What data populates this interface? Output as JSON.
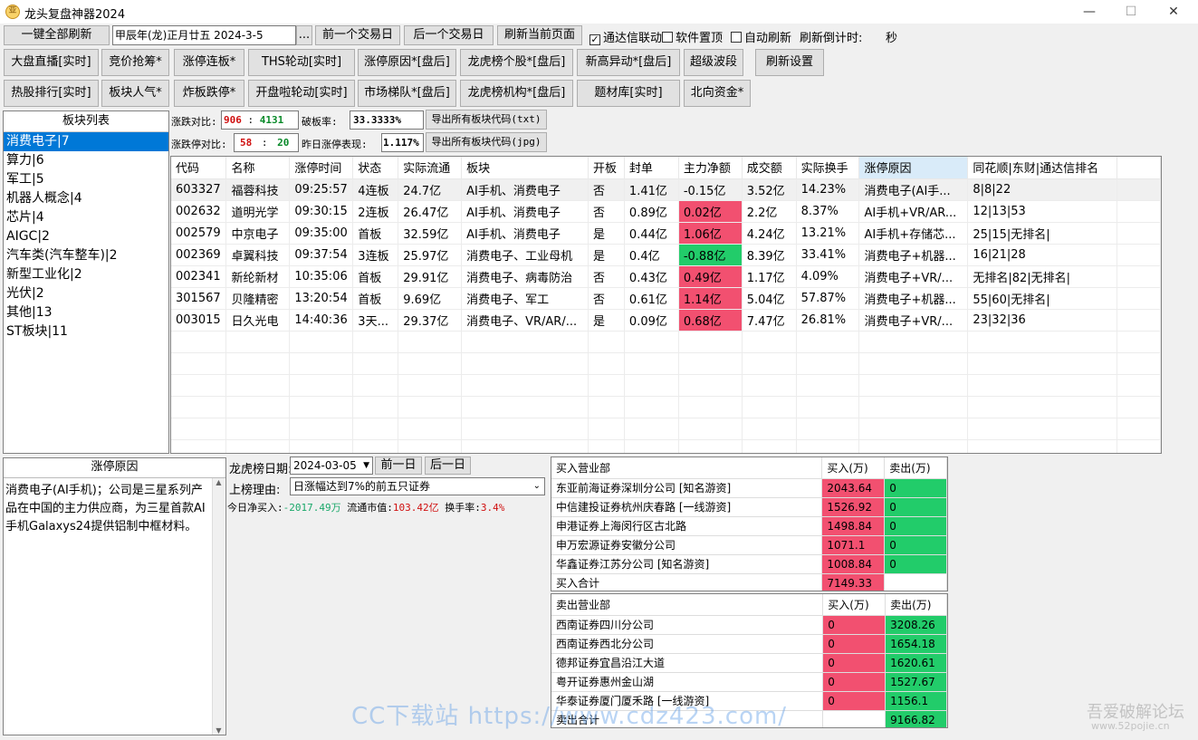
{
  "window": {
    "title": "龙头复盘神器2024",
    "icon_glyph": "亚"
  },
  "toolbar": {
    "refresh_all": "一键全部刷新",
    "date_value": "甲辰年(龙)正月廿五  2024-3-5",
    "date_picker": "...",
    "prev_day": "前一个交易日",
    "next_day": "后一个交易日",
    "refresh_page": "刷新当前页面",
    "tdx_link": "通达信联动",
    "pin_top": "软件置顶",
    "auto_refresh": "自动刷新",
    "countdown_label": "刷新倒计时:",
    "countdown_unit": "秒"
  },
  "nav_row1": [
    "大盘直播[实时]",
    "竞价抢筹*",
    "涨停连板*",
    "THS轮动[实时]",
    "涨停原因*[盘后]",
    "龙虎榜个股*[盘后]",
    "新高异动*[盘后]",
    "超级波段",
    "刷新设置"
  ],
  "nav_row2": [
    "热股排行[实时]",
    "板块人气*",
    "炸板跌停*",
    "开盘啦轮动[实时]",
    "市场梯队*[盘后]",
    "龙虎榜机构*[盘后]",
    "题材库[实时]",
    "北向资金*"
  ],
  "sector_list": {
    "header": "板块列表",
    "items": [
      "消费电子|7",
      "算力|6",
      "军工|5",
      "机器人概念|4",
      "芯片|4",
      "AIGC|2",
      "汽车类(汽车整车)|2",
      "新型工业化|2",
      "光伏|2",
      "其他|13",
      "ST板块|11"
    ]
  },
  "stats": {
    "updown_label": "涨跌对比:",
    "up_count": "906",
    "sep": ":",
    "down_count": "4131",
    "break_label": "破板率:",
    "break_rate": "33.3333%",
    "export_txt": "导出所有板块代码(txt)",
    "limit_label": "涨跌停对比:",
    "limit_up": "58",
    "limit_down": "20",
    "yesterday_label": "昨日涨停表现:",
    "yesterday_value": "1.117%",
    "export_jpg": "导出所有板块代码(jpg)"
  },
  "main_table": {
    "columns": [
      "代码",
      "名称",
      "涨停时间",
      "状态",
      "实际流通",
      "板块",
      "开板",
      "封单",
      "主力净额",
      "成交额",
      "实际换手",
      "涨停原因",
      "同花顺|东财|通达信排名"
    ],
    "rows": [
      [
        "603327",
        "福蓉科技",
        "09:25:57",
        "4连板",
        "24.7亿",
        "AI手机、消费电子",
        "否",
        "1.41亿",
        "-0.15亿",
        "3.52亿",
        "14.23%",
        "消费电子(AI手...",
        "8|8|22"
      ],
      [
        "002632",
        "道明光学",
        "09:30:15",
        "2连板",
        "26.47亿",
        "AI手机、消费电子",
        "否",
        "0.89亿",
        "0.02亿",
        "2.2亿",
        "8.37%",
        "AI手机+VR/AR...",
        "12|13|53"
      ],
      [
        "002579",
        "中京电子",
        "09:35:00",
        "首板",
        "32.59亿",
        "AI手机、消费电子",
        "是",
        "0.44亿",
        "1.06亿",
        "4.24亿",
        "13.21%",
        "AI手机+存储芯...",
        "25|15|无排名|"
      ],
      [
        "002369",
        "卓翼科技",
        "09:37:54",
        "3连板",
        "25.97亿",
        "消费电子、工业母机",
        "是",
        "0.4亿",
        "-0.88亿",
        "8.39亿",
        "33.41%",
        "消费电子+机器...",
        "16|21|28"
      ],
      [
        "002341",
        "新纶新材",
        "10:35:06",
        "首板",
        "29.91亿",
        "消费电子、病毒防治",
        "否",
        "0.43亿",
        "0.49亿",
        "1.17亿",
        "4.09%",
        "消费电子+VR/...",
        "无排名|82|无排名|"
      ],
      [
        "301567",
        "贝隆精密",
        "13:20:54",
        "首板",
        "9.69亿",
        "消费电子、军工",
        "否",
        "0.61亿",
        "1.14亿",
        "5.04亿",
        "57.87%",
        "消费电子+机器...",
        "55|60|无排名|"
      ],
      [
        "003015",
        "日久光电",
        "14:40:36",
        "3天...",
        "29.37亿",
        "消费电子、VR/AR/...",
        "是",
        "0.09亿",
        "0.68亿",
        "7.47亿",
        "26.81%",
        "消费电子+VR/...",
        "23|32|36"
      ]
    ],
    "net_flow_colors": [
      "none",
      "red",
      "red",
      "green",
      "red",
      "red",
      "red"
    ]
  },
  "reason_panel": {
    "header": "涨停原因",
    "text": "消费电子(AI手机)；公司是三星系列产品在中国的主力供应商，为三星首款AI手机Galaxys24提供铝制中框材料。"
  },
  "lhb": {
    "date_label": "龙虎榜日期:",
    "date_value": "2024-03-05",
    "prev": "前一日",
    "next": "后一日",
    "reason_label": "上榜理由:",
    "reason_value": "日涨幅达到7%的前五只证券",
    "net_buy_label": "今日净买入:",
    "net_buy_value": "-2017.49万",
    "float_label": "流通市值:",
    "float_value": "103.42亿",
    "turnover_label": "换手率:",
    "turnover_value": "3.4%"
  },
  "buy_table": {
    "columns": [
      "买入营业部",
      "买入(万)",
      "卖出(万)"
    ],
    "rows": [
      [
        "东亚前海证券深圳分公司 [知名游资]",
        "2043.64",
        "0"
      ],
      [
        "中信建投证券杭州庆春路 [一线游资]",
        "1526.92",
        "0"
      ],
      [
        "申港证券上海闵行区古北路",
        "1498.84",
        "0"
      ],
      [
        "申万宏源证券安徽分公司",
        "1071.1",
        "0"
      ],
      [
        "华鑫证券江苏分公司 [知名游资]",
        "1008.84",
        "0"
      ],
      [
        "买入合计",
        "7149.33",
        ""
      ]
    ]
  },
  "sell_table": {
    "columns": [
      "卖出营业部",
      "买入(万)",
      "卖出(万)"
    ],
    "rows": [
      [
        "西南证券四川分公司",
        "0",
        "3208.26"
      ],
      [
        "西南证券西北分公司",
        "0",
        "1654.18"
      ],
      [
        "德邦证券宜昌沿江大道",
        "0",
        "1620.61"
      ],
      [
        "粤开证券惠州金山湖",
        "0",
        "1527.67"
      ],
      [
        "华泰证券厦门厦禾路 [一线游资]",
        "0",
        "1156.1"
      ],
      [
        "卖出合计",
        "",
        "9166.82"
      ]
    ]
  },
  "watermarks": {
    "cc": "CC下载站  https://www.cdz423.com/",
    "pojie": "吾爱破解论坛",
    "pojie_url": "www.52pojie.cn"
  },
  "colors": {
    "red": "#f25070",
    "green": "#22cc6a",
    "selected": "#0078d7"
  }
}
